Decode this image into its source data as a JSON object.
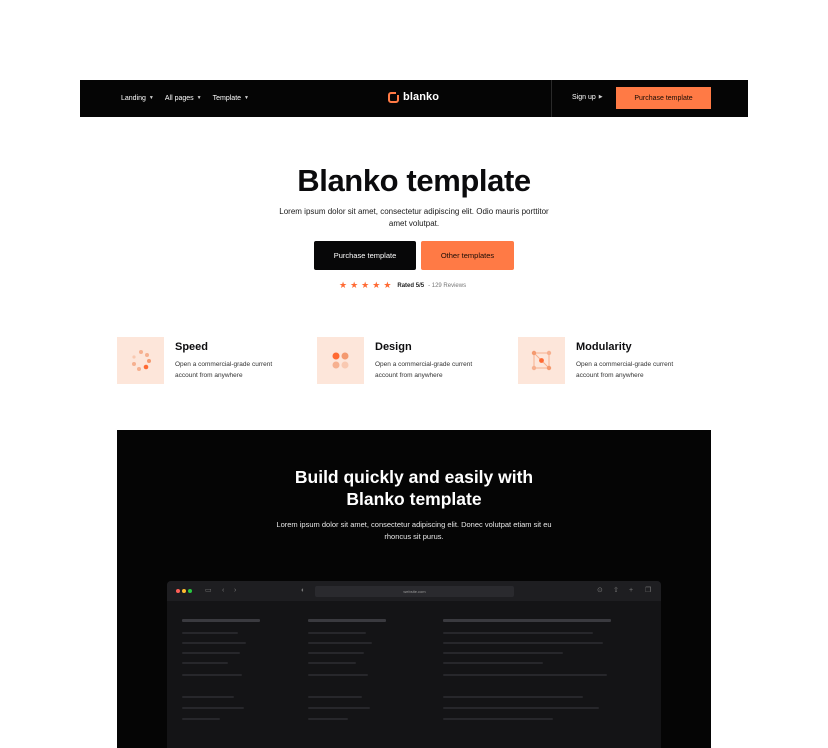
{
  "nav": {
    "links": [
      {
        "label": "Landing"
      },
      {
        "label": "All pages"
      },
      {
        "label": "Template"
      }
    ],
    "logo_text": "blanko",
    "signup_label": "Sign up",
    "cta_label": "Purchase template"
  },
  "hero": {
    "title": "Blanko template",
    "subtitle": "Lorem ipsum dolor sit amet, consectetur adipiscing elit. Odio mauris porttitor amet volutpat.",
    "primary_button": "Purchase template",
    "secondary_button": "Other templates",
    "rating_stars": 5,
    "rating_label": "Rated 5/5",
    "reviews_label": "- 129 Reviews"
  },
  "features": [
    {
      "title": "Speed",
      "description": "Open a commercial-grade current account from anywhere",
      "icon": "speed-icon"
    },
    {
      "title": "Design",
      "description": "Open a commercial-grade current account from anywhere",
      "icon": "design-icon"
    },
    {
      "title": "Modularity",
      "description": "Open a commercial-grade current account from anywhere",
      "icon": "modularity-icon"
    }
  ],
  "showcase": {
    "title_line1": "Build quickly and easily with",
    "title_line2": "Blanko template",
    "subtitle": "Lorem ipsum dolor sit amet, consectetur adipiscing elit. Donec volutpat etiam sit eu rhoncus sit purus.",
    "browser_url": "website.com"
  },
  "colors": {
    "accent": "#ff7a45",
    "dark": "#050505",
    "feature_bg": "#fde6da"
  }
}
